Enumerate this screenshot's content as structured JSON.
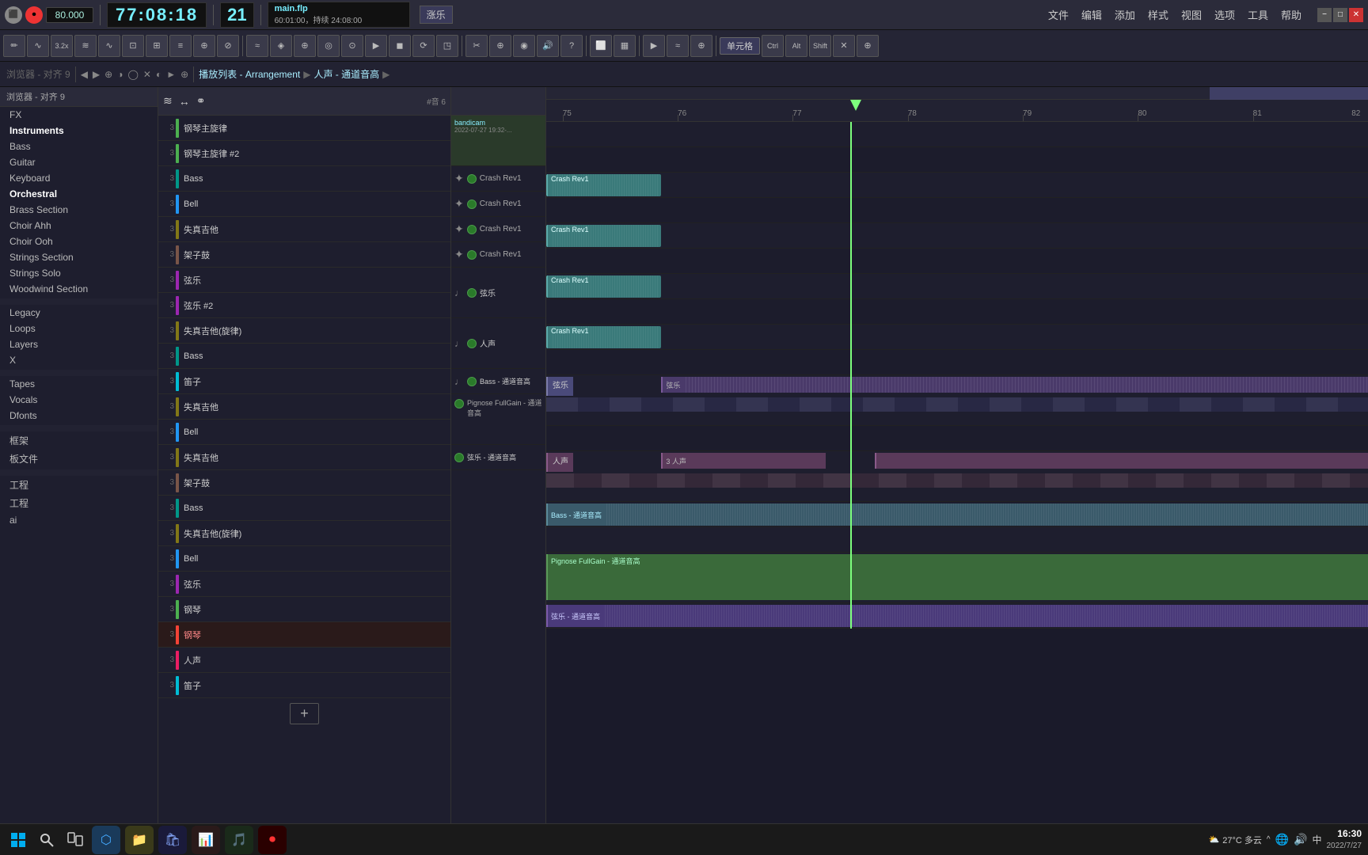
{
  "topBar": {
    "bpm": "80.000",
    "time": "77:08:18",
    "bar": "21",
    "fileInfo": {
      "name": "main.flp",
      "duration": "60:01:00，持续 24:08:00",
      "label": "涨乐"
    },
    "menuItems": [
      "文件",
      "编辑",
      "添加",
      "样式",
      "视图",
      "选项",
      "工具",
      "帮助"
    ]
  },
  "toolbar": {
    "items": [
      "⊞",
      "∿",
      "3.2x",
      "≋",
      "∿",
      "⊡",
      "⊞",
      "≡",
      "⊕",
      "⊘",
      "≈",
      "◈",
      "⊕",
      "◎",
      "⊙",
      "▶",
      "◼",
      "⟳",
      "◳",
      "✂",
      "⊕",
      "◉",
      "🔊",
      "?",
      "⬜",
      "▦",
      "▶",
      "≈",
      "⊕",
      "Ctrl",
      "Alt",
      "Shift",
      "✕",
      "⊕"
    ]
  },
  "navBar": {
    "breadcrumb": [
      "播放列表 - Arrangement",
      "人声 - 通道音高"
    ],
    "navBtns": [
      "◀",
      "▶",
      "⊕",
      "◑",
      "◯",
      "✕",
      "◐",
      "►",
      "⊕"
    ]
  },
  "sidebar": {
    "header": "浏览器 - 对齐 9",
    "sections": [
      {
        "label": "FX",
        "items": []
      },
      {
        "label": "Instruments",
        "items": [
          "Bass",
          "Guitar",
          "Keyboard",
          "Orchestral",
          "Brass Section",
          "Choir Ahh",
          "Choir Ooh",
          "Strings Section",
          "Strings Solo",
          "Woodwind Section"
        ]
      },
      {
        "label": "Legacy",
        "items": [
          "Loops",
          "Layers",
          "X"
        ]
      },
      {
        "label": "Tapes",
        "items": []
      },
      {
        "label": "Vocals",
        "items": []
      },
      {
        "label": "Dfonts",
        "items": []
      },
      {
        "label": "",
        "items": []
      },
      {
        "label": "框架",
        "items": []
      },
      {
        "label": "板文件",
        "items": []
      },
      {
        "label": "",
        "items": []
      },
      {
        "label": "工程",
        "items": []
      },
      {
        "label": "工程",
        "items": []
      },
      {
        "label": "ai",
        "items": []
      }
    ]
  },
  "trackList": {
    "tracks": [
      {
        "num": "3",
        "color": "tc-green",
        "label": "钢琴主旋律",
        "icon": "🎹"
      },
      {
        "num": "3",
        "color": "tc-green",
        "label": "钢琴主旋律 #2",
        "icon": "🎹"
      },
      {
        "num": "3",
        "color": "tc-teal",
        "label": "Bass",
        "icon": "🎸"
      },
      {
        "num": "3",
        "color": "tc-blue",
        "label": "Bell",
        "icon": "🎵"
      },
      {
        "num": "3",
        "color": "tc-olive",
        "label": "失真吉他",
        "icon": "🎸"
      },
      {
        "num": "3",
        "color": "tc-brown",
        "label": "架子鼓",
        "icon": "🥁"
      },
      {
        "num": "3",
        "color": "tc-purple",
        "label": "弦乐",
        "icon": "🎻"
      },
      {
        "num": "3",
        "color": "tc-purple",
        "label": "弦乐 #2",
        "icon": "🎻"
      },
      {
        "num": "3",
        "color": "tc-olive",
        "label": "失真吉他(旋律)",
        "icon": "🎸"
      },
      {
        "num": "3",
        "color": "tc-teal",
        "label": "Bass",
        "icon": "🎸"
      },
      {
        "num": "3",
        "color": "tc-cyan",
        "label": "笛子",
        "icon": "🎵"
      },
      {
        "num": "3",
        "color": "tc-olive",
        "label": "失真吉他",
        "icon": "🎸"
      },
      {
        "num": "3",
        "color": "tc-blue",
        "label": "Bell",
        "icon": "🎵"
      },
      {
        "num": "3",
        "color": "tc-olive",
        "label": "失真吉他",
        "icon": "🎸"
      },
      {
        "num": "3",
        "color": "tc-brown",
        "label": "架子鼓",
        "icon": "🥁"
      },
      {
        "num": "3",
        "color": "tc-teal",
        "label": "Bass",
        "icon": "🎸"
      },
      {
        "num": "3",
        "color": "tc-olive",
        "label": "失真吉他(旋律)",
        "icon": "🎸"
      },
      {
        "num": "3",
        "color": "tc-blue",
        "label": "Bell",
        "icon": "🎵"
      },
      {
        "num": "3",
        "color": "tc-purple",
        "label": "弦乐",
        "icon": "🎻"
      },
      {
        "num": "3",
        "color": "tc-green",
        "label": "钢琴",
        "icon": "🎹"
      },
      {
        "num": "3",
        "color": "tc-red",
        "label": "钢琴",
        "icon": "🎹"
      },
      {
        "num": "3",
        "color": "tc-pink",
        "label": "人声",
        "icon": "🎤"
      },
      {
        "num": "3",
        "color": "tc-cyan",
        "label": "笛子",
        "icon": "🎵"
      }
    ]
  },
  "arrange": {
    "ruler": {
      "marks": [
        "75",
        "76",
        "77",
        "78",
        "79",
        "80",
        "81",
        "82"
      ]
    },
    "playheadPos": "38%",
    "clips": [
      {
        "row": 0,
        "label": "bandicam\n2022-07-27 19:32-...",
        "left": "0%",
        "width": "12%",
        "colorClass": "clip-green"
      },
      {
        "row": 2,
        "label": "Crash Rev1",
        "left": "0%",
        "width": "8%",
        "colorClass": "clip-teal"
      },
      {
        "row": 4,
        "label": "Crash Rev1",
        "left": "0%",
        "width": "8%",
        "colorClass": "clip-teal"
      },
      {
        "row": 6,
        "label": "Crash Rev1",
        "left": "0%",
        "width": "8%",
        "colorClass": "clip-teal"
      },
      {
        "row": 8,
        "label": "Crash Rev1",
        "left": "0%",
        "width": "8%",
        "colorClass": "clip-teal"
      },
      {
        "row": 10,
        "label": "弦乐",
        "left": "0%",
        "width": "8%",
        "colorClass": "clip-purple"
      },
      {
        "row": 12,
        "label": "人声",
        "left": "0%",
        "width": "8%",
        "colorClass": "clip-pink"
      },
      {
        "row": 14,
        "label": "Bass - 通道音高",
        "left": "0%",
        "width": "8%",
        "colorClass": "clip-teal"
      }
    ]
  },
  "mixerBar": {
    "buttons": [
      "单元格",
      "⊕",
      "⊞"
    ],
    "mode": "单元格"
  },
  "taskbar": {
    "apps": [
      {
        "name": "windows-search",
        "icon": "🔍"
      },
      {
        "name": "start-btn",
        "icon": "⊞"
      },
      {
        "name": "task-view",
        "icon": "⬜"
      },
      {
        "name": "edge-browser",
        "icon": "🌐"
      },
      {
        "name": "file-explorer",
        "icon": "📁"
      },
      {
        "name": "store",
        "icon": "🛍"
      },
      {
        "name": "app5",
        "icon": "📊"
      },
      {
        "name": "app6",
        "icon": "🎮"
      },
      {
        "name": "app7",
        "icon": "🎵"
      },
      {
        "name": "app8",
        "icon": "🔴"
      }
    ],
    "weather": "27°C 多云",
    "time": "16:30",
    "date": "2022/7/27",
    "systemIcons": [
      "🔔",
      "⬆",
      "🔊",
      "🌐",
      "中"
    ]
  },
  "Section": "Section"
}
